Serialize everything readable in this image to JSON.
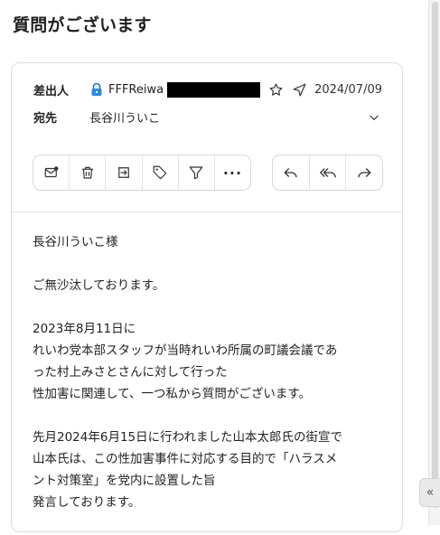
{
  "email": {
    "subject": "質問がございます",
    "from_label": "差出人",
    "from_name": "FFFReiwa",
    "date": "2024/07/09",
    "to_label": "宛先",
    "to_name": "長谷川ういこ"
  },
  "toolbar": {
    "left": [
      {
        "name": "mark-unread-icon"
      },
      {
        "name": "delete-icon"
      },
      {
        "name": "move-icon"
      },
      {
        "name": "tag-icon"
      },
      {
        "name": "filter-icon"
      },
      {
        "name": "more-icon",
        "label": "···"
      }
    ],
    "right": [
      {
        "name": "reply-icon"
      },
      {
        "name": "reply-all-icon"
      },
      {
        "name": "forward-icon"
      }
    ]
  },
  "body": {
    "greeting": "長谷川ういこ様",
    "p1": "ご無沙汰しております。",
    "p2": [
      "2023年8月11日に",
      "れいわ党本部スタッフが当時れいわ所属の町議会議であ",
      "った村上みさとさんに対して行った",
      "性加害に関連して、一つ私から質問がございます。"
    ],
    "p3": [
      "先月2024年6月15日に行われました山本太郎氏の街宣で",
      "山本氏は、この性加害事件に対応する目的で「ハラスメ",
      "ント対策室」を党内に設置した旨",
      "発言しております。"
    ]
  },
  "collapse_glyph": "«"
}
